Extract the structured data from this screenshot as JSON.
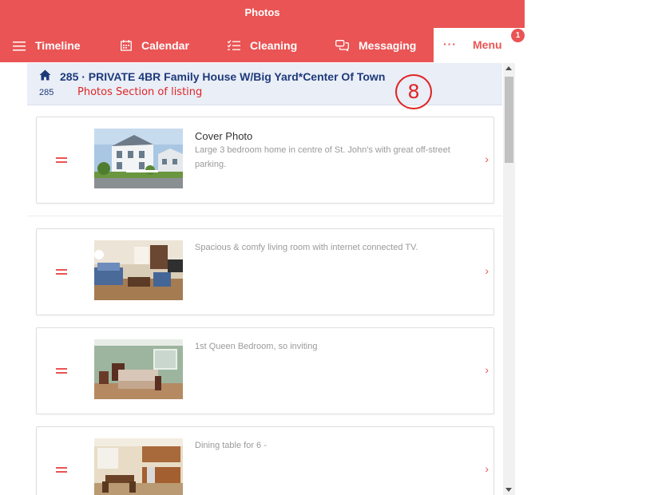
{
  "header": {
    "title": "Photos",
    "nav": {
      "timeline": "Timeline",
      "calendar": "Calendar",
      "cleaning": "Cleaning",
      "messaging": "Messaging",
      "menu": "Menu",
      "menu_dots": "···",
      "menu_badge": "1"
    }
  },
  "listing": {
    "title": "285 · PRIVATE 4BR Family House W/Big Yard*Center Of Town",
    "id": "285",
    "annotation_text": "Photos Section of listing",
    "annotation_number": "8"
  },
  "photos": [
    {
      "title": "Cover Photo",
      "description": "Large 3 bedroom home in centre of St. John's with great off-street parking."
    },
    {
      "title": "",
      "description": "Spacious & comfy living room with internet connected TV."
    },
    {
      "title": "",
      "description": "1st Queen Bedroom, so inviting"
    },
    {
      "title": "",
      "description": "Dining table for 6 -"
    }
  ],
  "icons": {
    "chevron": "›",
    "accent_color": "#ea5454",
    "header_color": "#1f3a7a"
  }
}
